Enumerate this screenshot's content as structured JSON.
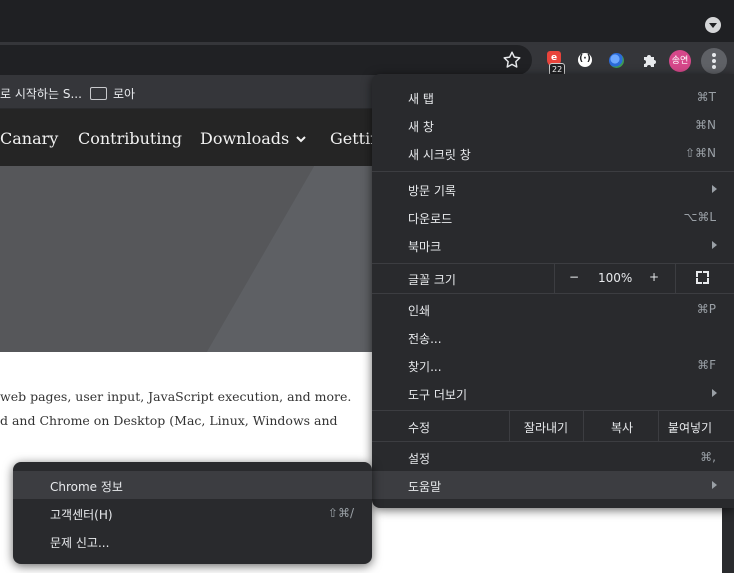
{
  "toolbar": {
    "extension_badge": "22",
    "profile_initials": "송연"
  },
  "bookmarks": [
    {
      "label": "로 시작하는 S..."
    },
    {
      "label": "로아"
    }
  ],
  "site_nav": [
    "Canary",
    "Contributing",
    "Downloads",
    "Gettin"
  ],
  "page_text": [
    "web pages, user input, JavaScript execution, and more.",
    "d and Chrome on Desktop (Mac, Linux, Windows and"
  ],
  "menu": {
    "new_tab": {
      "label": "새 탭",
      "shortcut": "⌘T"
    },
    "new_window": {
      "label": "새 창",
      "shortcut": "⌘N"
    },
    "new_incognito": {
      "label": "새 시크릿 창",
      "shortcut": "⇧⌘N"
    },
    "history": {
      "label": "방문 기록"
    },
    "downloads": {
      "label": "다운로드",
      "shortcut": "⌥⌘L"
    },
    "bookmarks": {
      "label": "북마크"
    },
    "zoom": {
      "label": "글꼴 크기",
      "minus": "−",
      "value": "100%",
      "plus": "+"
    },
    "print": {
      "label": "인쇄",
      "shortcut": "⌘P"
    },
    "cast": {
      "label": "전송..."
    },
    "find": {
      "label": "찾기...",
      "shortcut": "⌘F"
    },
    "more_tools": {
      "label": "도구 더보기"
    },
    "edit": {
      "label": "수정",
      "cut": "잘라내기",
      "copy": "복사",
      "paste": "붙여넣기"
    },
    "settings": {
      "label": "설정",
      "shortcut": "⌘,"
    },
    "help": {
      "label": "도움말"
    }
  },
  "help_submenu": {
    "about": {
      "label": "Chrome 정보"
    },
    "help_center": {
      "label": "고객센터(H)",
      "shortcut": "⇧⌘/"
    },
    "report_issue": {
      "label": "문제 신고..."
    }
  }
}
